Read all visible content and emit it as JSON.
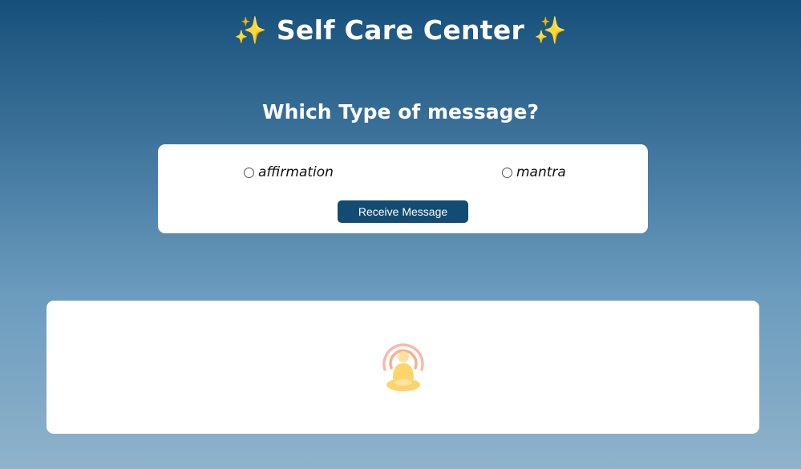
{
  "header": {
    "sparkle_left": "✨",
    "title": "Self Care Center",
    "sparkle_right": "✨"
  },
  "question": "Which Type of message?",
  "options": [
    {
      "label": "affirmation",
      "selected": false
    },
    {
      "label": "mantra",
      "selected": false
    }
  ],
  "receive_button": {
    "label": "Receive Message"
  },
  "message_panel": {
    "icon": "meditation-icon"
  },
  "colors": {
    "background_top": "#16507a",
    "background_bottom": "#8fb3cb",
    "button": "#134c72",
    "card": "#ffffff",
    "icon_body": "#fdd36b",
    "icon_rings": "#f7a27a"
  }
}
